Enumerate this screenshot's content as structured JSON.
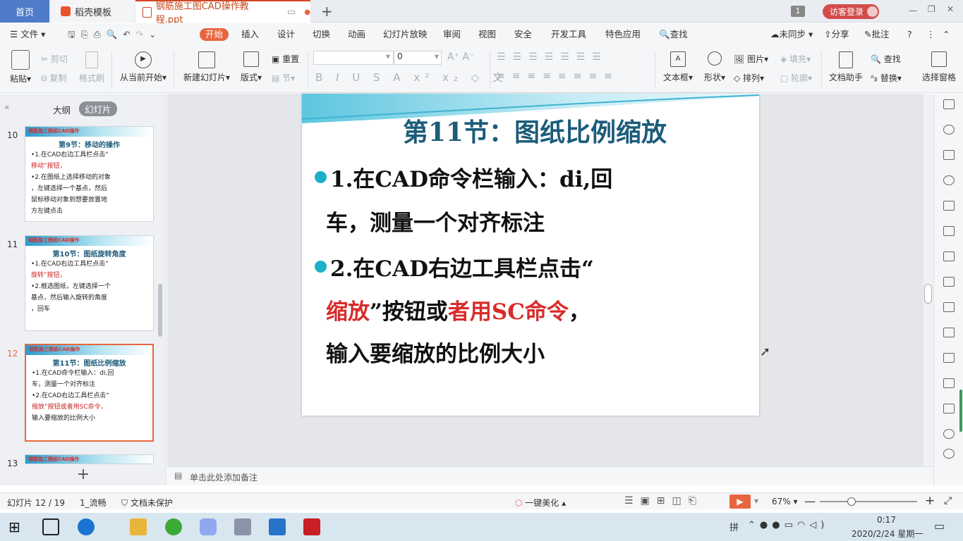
{
  "tabs": {
    "home": "首页",
    "template": "稻壳模板",
    "doc": "钢筋施工图CAD操作教程.ppt",
    "badge": "1",
    "visitor": "访客登录"
  },
  "menu": {
    "file": "文件",
    "items": [
      "开始",
      "插入",
      "设计",
      "切换",
      "动画",
      "幻灯片放映",
      "审阅",
      "视图",
      "安全",
      "开发工具",
      "特色应用"
    ],
    "search": "查找",
    "sync": "未同步",
    "share": "分享",
    "comment": "批注"
  },
  "ribbon": {
    "paste": "粘贴",
    "cut": "剪切",
    "copy": "复制",
    "format_painter": "格式刷",
    "from_current": "从当前开始",
    "new_slide": "新建幻灯片",
    "layout": "版式",
    "reset": "重置",
    "section": "节",
    "font_size": "0",
    "textbox": "文本框",
    "shape": "形状",
    "picture": "图片",
    "fill": "填充",
    "arrange": "排列",
    "outline": "轮廓",
    "doc_helper": "文档助手",
    "find": "查找",
    "replace": "替换",
    "select_pane": "选择窗格"
  },
  "panel": {
    "outline_tab": "大纲",
    "slides_tab": "幻灯片"
  },
  "thumbs": [
    {
      "num": "10",
      "band": "钢筋施工图纸CAD操作",
      "title": "第9节：移动的操作",
      "lines": [
        "•1.在CAD右边工具栏点击“",
        "移动”按钮，",
        "•2.在图纸上选择移动的对象",
        "，左键选择一个基点，然后",
        "鼠标移动对象到想要放置地",
        "方左键点击"
      ]
    },
    {
      "num": "11",
      "band": "钢筋施工图纸CAD操作",
      "title": "第10节：图纸旋转角度",
      "lines": [
        "•1.在CAD右边工具栏点击“",
        "旋转”按钮，",
        "•2.框选图纸，左键选择一个",
        "基点，然后输入旋转的角度",
        "，回车"
      ]
    },
    {
      "num": "12",
      "band": "钢筋施工图纸CAD操作",
      "title": "第11节：图纸比例缩放",
      "lines": [
        "•1.在CAD命令栏输入：di,回",
        "车，测量一个对齐标注",
        "•2.在CAD右边工具栏点击“",
        "缩放”按钮或者用SC命令，",
        "输入要缩放的比例大小"
      ]
    },
    {
      "num": "13",
      "band": "钢筋施工图纸CAD操作"
    }
  ],
  "slide": {
    "title": "第11节：图纸比例缩放",
    "b1_l1": "1.在CAD命令栏输入：di,回",
    "b1_l2": "车，测量一个对齐标注",
    "b2_l1": "2.在CAD右边工具栏点击“",
    "b2_red1": "缩放",
    "b2_mid": "”按钮或",
    "b2_red2": "者用SC命令",
    "b2_end": "，",
    "b2_l3": "输入要缩放的比例大小"
  },
  "notes": {
    "placeholder": "单击此处添加备注"
  },
  "status": {
    "slide_pos": "幻灯片 12 / 19",
    "theme": "1_流畅",
    "protect": "文档未保护",
    "beautify": "一键美化",
    "zoom": "67%"
  },
  "taskbar": {
    "time": "0:17",
    "date": "2020/2/24 星期一",
    "ime": "拼"
  },
  "colors": {
    "accent": "#e8663f",
    "title_teal": "#1c5c7a",
    "red": "#d92b2b",
    "bullet": "#1ab1c9"
  }
}
